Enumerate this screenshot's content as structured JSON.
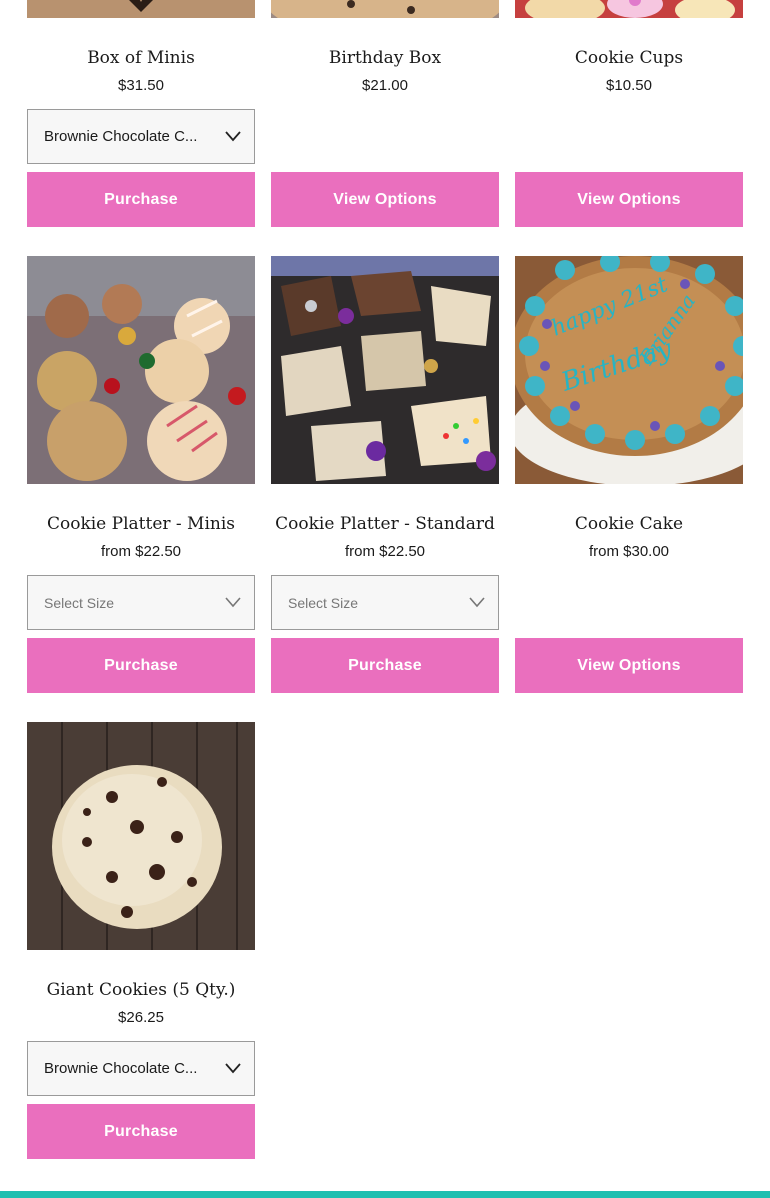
{
  "products": [
    {
      "name": "Box of Minis",
      "price": "$31.50",
      "select_value": "Brownie Chocolate C...",
      "button": "Purchase"
    },
    {
      "name": "Birthday Box",
      "price": "$21.00",
      "button": "View Options"
    },
    {
      "name": "Cookie Cups",
      "price": "$10.50",
      "button": "View Options"
    },
    {
      "name": "Cookie Platter - Minis",
      "price": "from $22.50",
      "select_value": "Select Size",
      "button": "Purchase"
    },
    {
      "name": "Cookie Platter - Standard",
      "price": "from $22.50",
      "select_value": "Select Size",
      "button": "Purchase"
    },
    {
      "name": "Cookie Cake",
      "price": "from $30.00",
      "button": "View Options"
    },
    {
      "name": "Giant Cookies (5 Qty.)",
      "price": "$26.25",
      "select_value": "Brownie Chocolate C...",
      "button": "Purchase"
    }
  ],
  "images": {
    "cookie_cake_text": "Happy 2¹ᵗ Birthday Brianna"
  },
  "colors": {
    "button": "#ea6fbe",
    "footer_bar": "#1fbfb0"
  },
  "icons": {
    "dropdown": "chevron-down-icon"
  }
}
